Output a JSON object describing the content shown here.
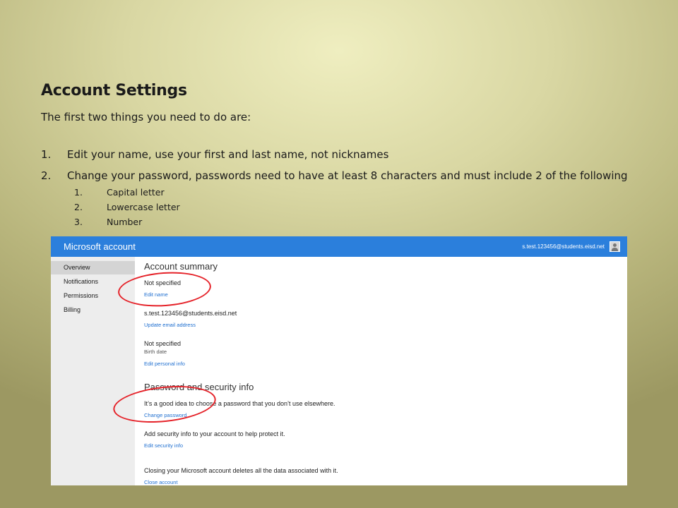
{
  "slide": {
    "title": "Account Settings",
    "intro": "The first two things you need to do are:",
    "steps": [
      {
        "num": "1.",
        "text": "Edit your name, use your first and last name, not nicknames"
      },
      {
        "num": "2.",
        "text": "Change your password, passwords need to have at least 8 characters and must include 2 of the following"
      }
    ],
    "substeps": [
      {
        "num": "1.",
        "text": "Capital letter"
      },
      {
        "num": "2.",
        "text": "Lowercase letter"
      },
      {
        "num": "3.",
        "text": "Number"
      }
    ]
  },
  "app": {
    "brand": "Microsoft account",
    "user_email": "s.test.123456@students.eisd.net",
    "accent_color": "#2b7fdc",
    "sidebar": {
      "items": [
        {
          "label": "Overview",
          "active": true
        },
        {
          "label": "Notifications"
        },
        {
          "label": "Permissions"
        },
        {
          "label": "Billing"
        }
      ]
    },
    "summary": {
      "heading": "Account summary",
      "name_value": "Not specified",
      "edit_name": "Edit name",
      "email_value": "s.test.123456@students.eisd.net",
      "update_email": "Update email address",
      "birth_value": "Not specified",
      "birth_label": "Birth date",
      "edit_personal": "Edit personal info"
    },
    "security": {
      "heading": "Password and security info",
      "password_text": "It’s a good idea to choose a password that you don’t use elsewhere.",
      "change_password": "Change password",
      "security_text": "Add security info to your account to help protect it.",
      "edit_security": "Edit security info",
      "close_text": "Closing your Microsoft account deletes all the data associated with it.",
      "close_account": "Close account"
    },
    "annotation_color": "#e52229"
  }
}
